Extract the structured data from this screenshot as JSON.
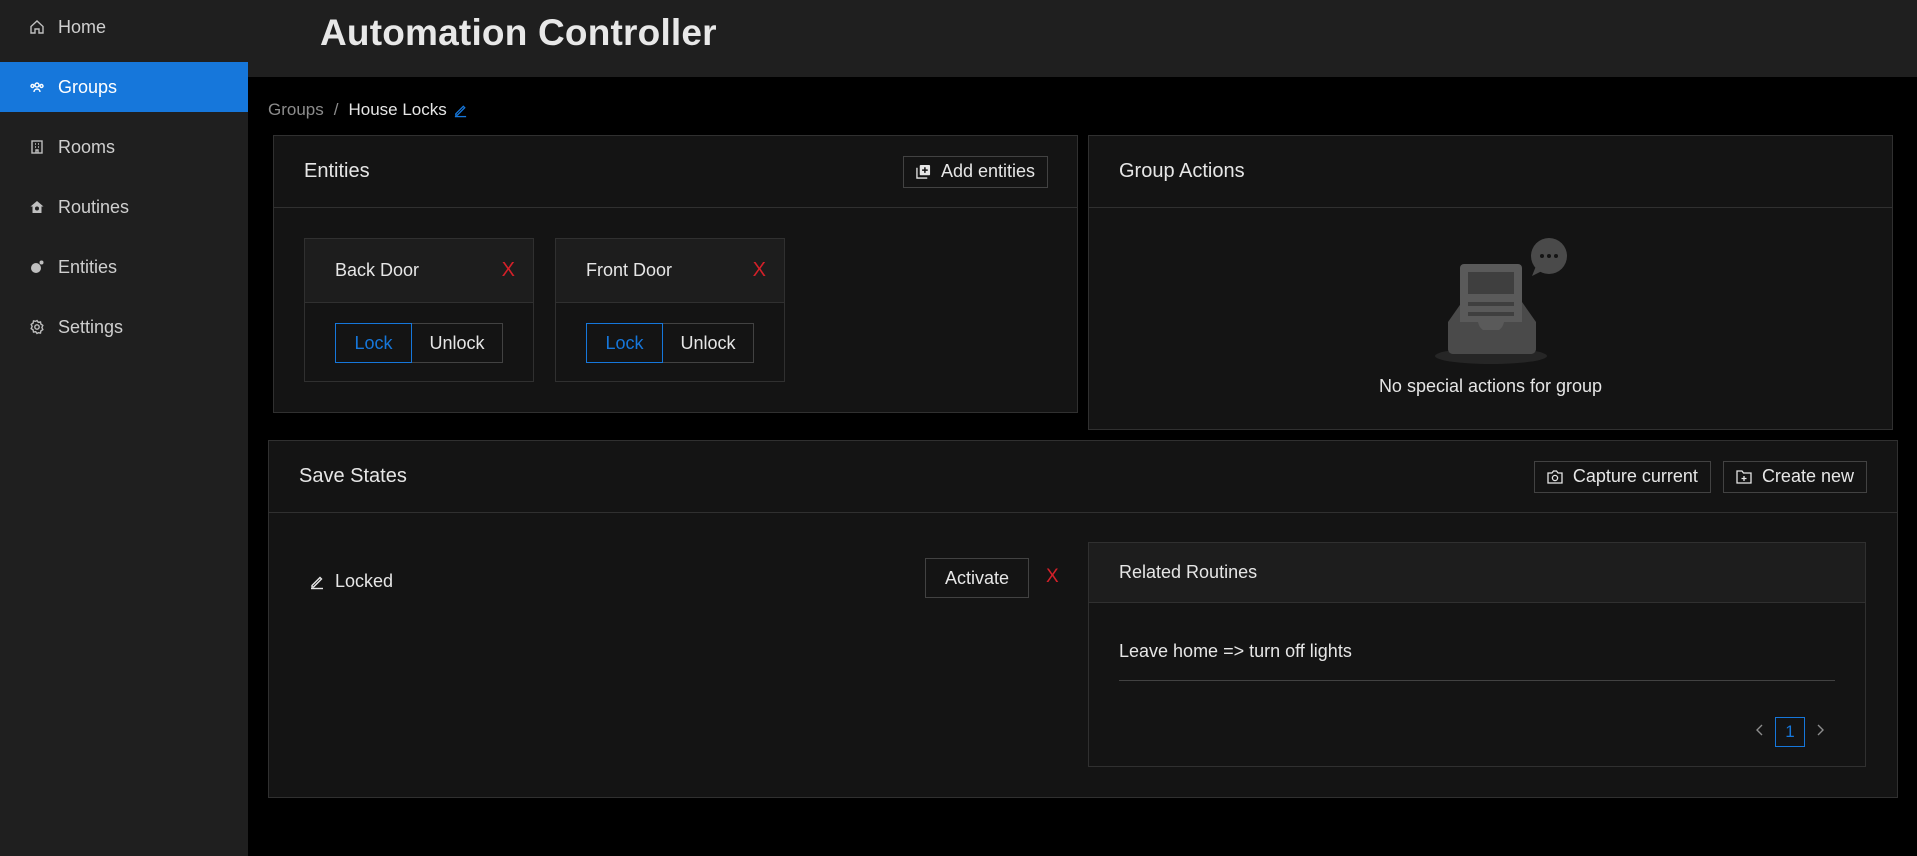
{
  "app": {
    "title": "Automation Controller"
  },
  "sidebar": {
    "items": [
      {
        "label": "Home",
        "icon": "home-icon",
        "active": false
      },
      {
        "label": "Groups",
        "icon": "groups-icon",
        "active": true
      },
      {
        "label": "Rooms",
        "icon": "rooms-icon",
        "active": false
      },
      {
        "label": "Routines",
        "icon": "routines-icon",
        "active": false
      },
      {
        "label": "Entities",
        "icon": "entities-icon",
        "active": false
      },
      {
        "label": "Settings",
        "icon": "gear-icon",
        "active": false
      }
    ]
  },
  "breadcrumb": {
    "parent": "Groups",
    "separator": "/",
    "current": "House Locks"
  },
  "entities": {
    "title": "Entities",
    "add_label": "Add entities",
    "items": [
      {
        "name": "Back Door",
        "lock_label": "Lock",
        "unlock_label": "Unlock",
        "remove": "X"
      },
      {
        "name": "Front Door",
        "lock_label": "Lock",
        "unlock_label": "Unlock",
        "remove": "X"
      }
    ]
  },
  "group_actions": {
    "title": "Group Actions",
    "empty_text": "No special actions for group"
  },
  "save_states": {
    "title": "Save States",
    "capture_label": "Capture current",
    "create_label": "Create new",
    "states": [
      {
        "name": "Locked",
        "activate_label": "Activate",
        "remove": "X"
      }
    ],
    "related": {
      "title": "Related Routines",
      "routines": [
        "Leave home => turn off lights"
      ],
      "pagination": {
        "current": "1"
      }
    }
  },
  "colors": {
    "accent": "#1677db",
    "danger": "#d32029",
    "panel": "#141414",
    "sidebar": "#1f1f1f"
  }
}
